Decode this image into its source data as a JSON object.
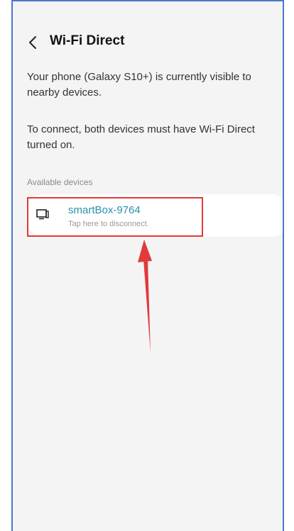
{
  "screen": {
    "title": "Wi-Fi Direct",
    "description_visible": "Your phone (Galaxy S10+) is currently visible to nearby devices.",
    "description_connect": "To connect, both devices must have Wi-Fi Direct turned on.",
    "section_label": "Available devices"
  },
  "devices": [
    {
      "name": "smartBox-9764",
      "status": "Tap here to disconnect.",
      "icon": "tv-monitor-icon"
    }
  ],
  "colors": {
    "accent": "#2a8fb0",
    "highlight": "#e03a3a",
    "frame": "#4a78c9"
  },
  "icons": {
    "back": "back-chevron-icon",
    "annotation_arrow": "red-arrow-icon"
  }
}
